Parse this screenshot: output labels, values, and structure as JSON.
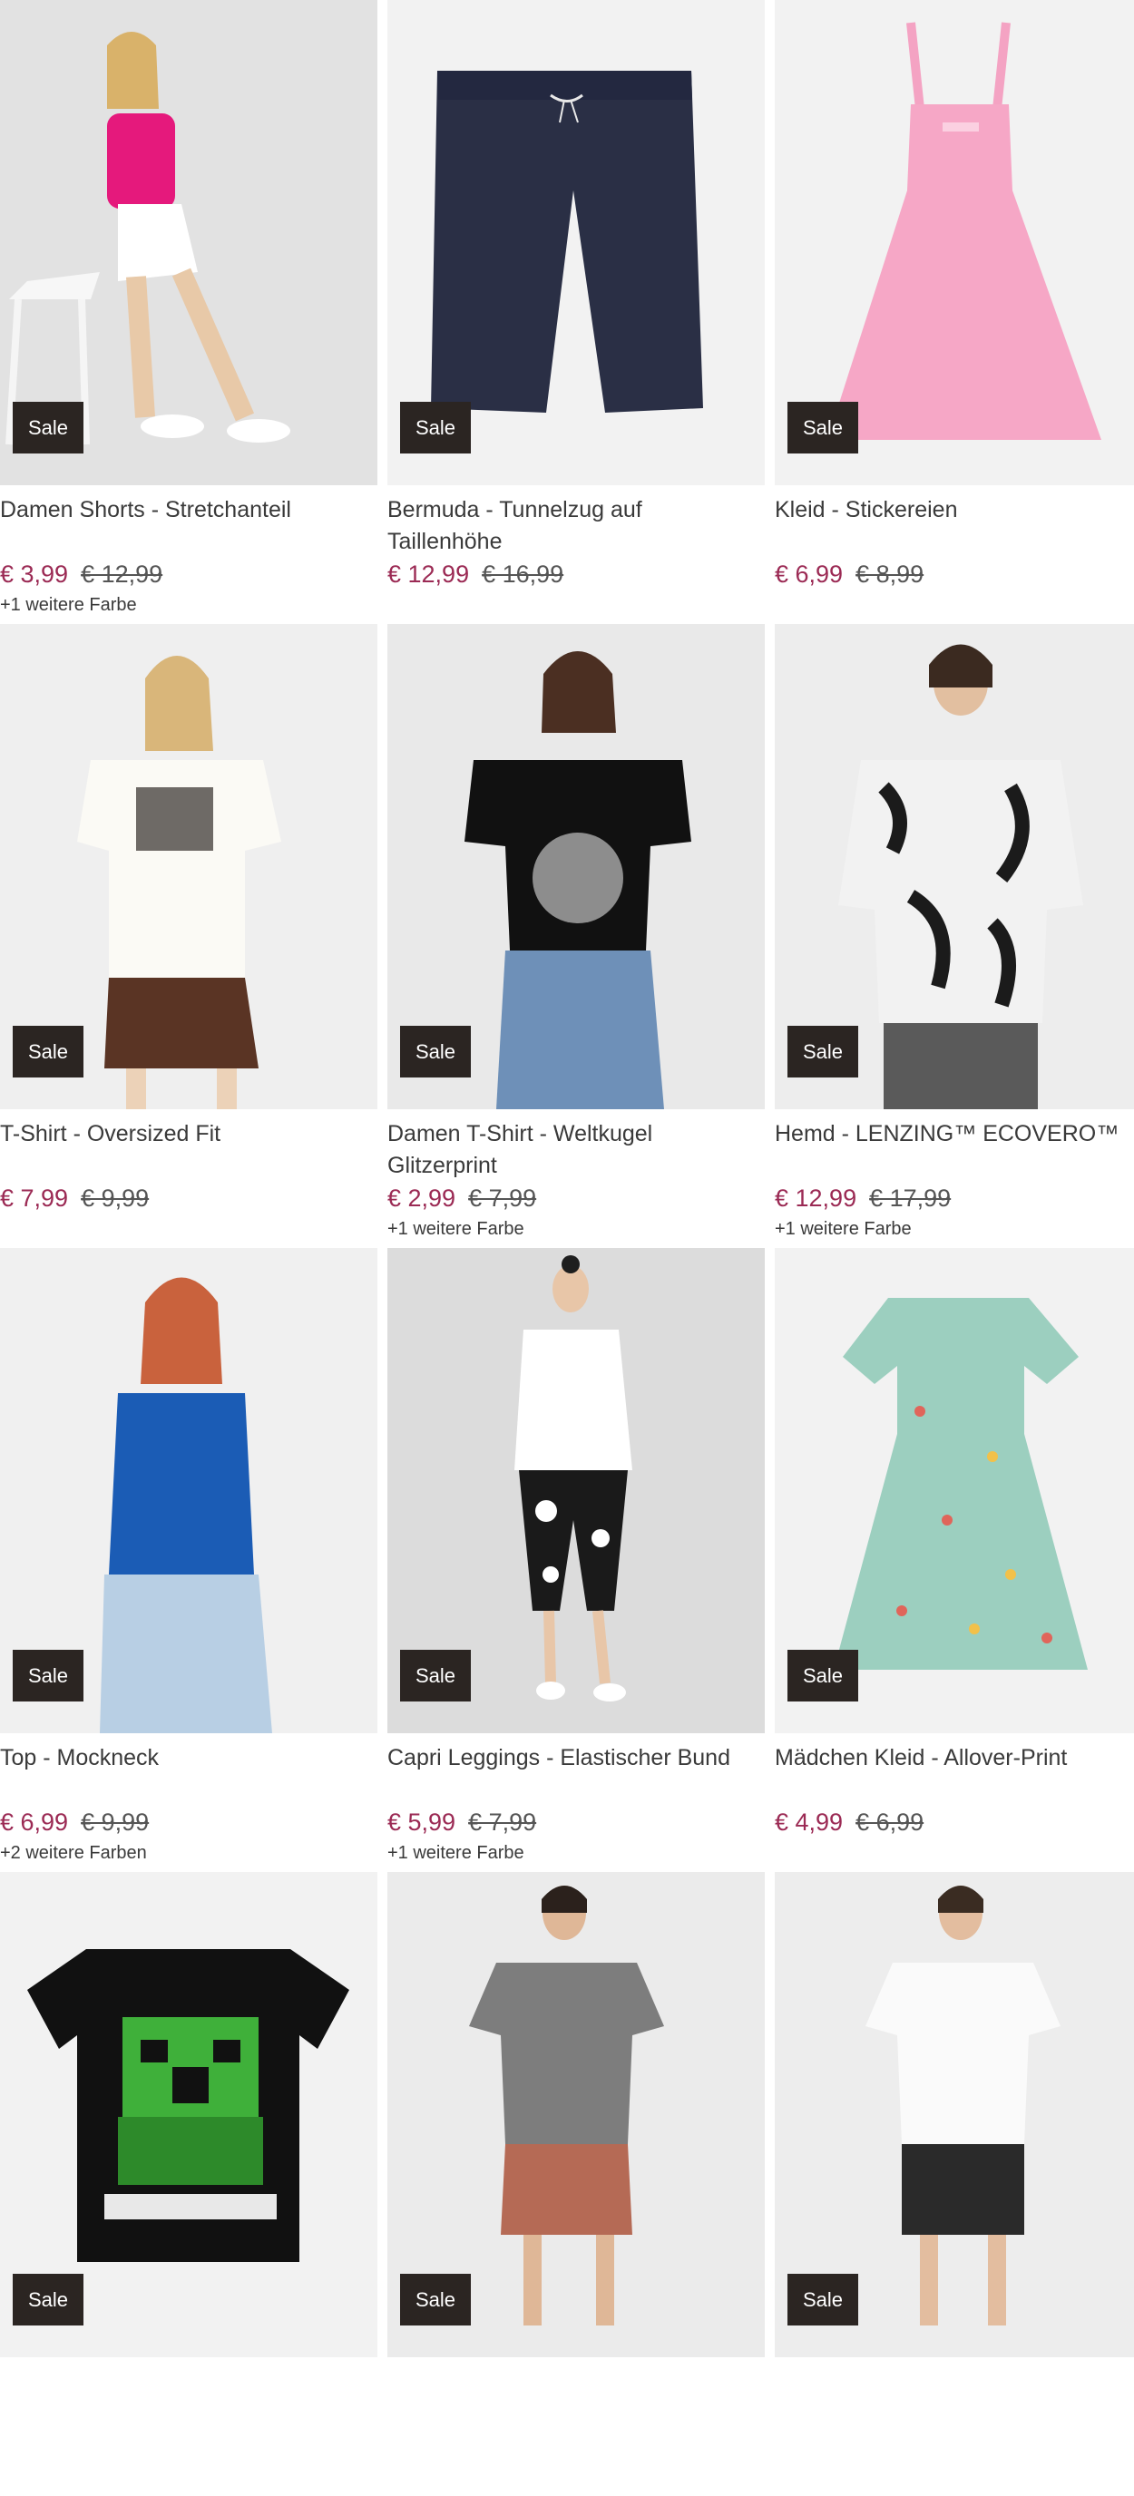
{
  "badge_label": "Sale",
  "colors": {
    "price": "#9b2a54",
    "badge_bg": "#2b2522",
    "text": "#3a3a3a"
  },
  "products": [
    {
      "title": "Damen Shorts - Stretchanteil",
      "price": "€ 3,99",
      "old_price": "€ 12,99",
      "colors_note": "+1 weitere Farbe",
      "image": "woman-pink-top-white-shorts"
    },
    {
      "title": "Bermuda - Tunnelzug auf Taillenhöhe",
      "price": "€ 12,99",
      "old_price": "€ 16,99",
      "colors_note": "",
      "image": "navy-bermuda-shorts"
    },
    {
      "title": "Kleid - Stickereien",
      "price": "€ 6,99",
      "old_price": "€ 8,99",
      "colors_note": "",
      "image": "pink-dress"
    },
    {
      "title": "T-Shirt - Oversized Fit",
      "price": "€ 7,99",
      "old_price": "€ 9,99",
      "colors_note": "",
      "image": "woman-white-tshirt-brown-shorts"
    },
    {
      "title": "Damen T-Shirt - Weltkugel Glitzerprint",
      "price": "€ 2,99",
      "old_price": "€ 7,99",
      "colors_note": "+1 weitere Farbe",
      "image": "woman-black-tshirt-jeans"
    },
    {
      "title": "Hemd - LENZING™ ECOVERO™",
      "price": "€ 12,99",
      "old_price": "€ 17,99",
      "colors_note": "+1 weitere Farbe",
      "image": "man-floral-shirt"
    },
    {
      "title": "Top - Mockneck",
      "price": "€ 6,99",
      "old_price": "€ 9,99",
      "colors_note": "+2 weitere Farben",
      "image": "woman-blue-top"
    },
    {
      "title": "Capri Leggings - Elastischer Bund",
      "price": "€ 5,99",
      "old_price": "€ 7,99",
      "colors_note": "+1 weitere Farbe",
      "image": "woman-printed-leggings"
    },
    {
      "title": "Mädchen Kleid - Allover-Print",
      "price": "€ 4,99",
      "old_price": "€ 6,99",
      "colors_note": "",
      "image": "mint-printed-dress"
    },
    {
      "title": "",
      "price": "",
      "old_price": "",
      "colors_note": "",
      "image": "minecraft-tshirt"
    },
    {
      "title": "",
      "price": "",
      "old_price": "",
      "colors_note": "",
      "image": "man-grey-tshirt"
    },
    {
      "title": "",
      "price": "",
      "old_price": "",
      "colors_note": "",
      "image": "man-white-tshirt"
    }
  ]
}
